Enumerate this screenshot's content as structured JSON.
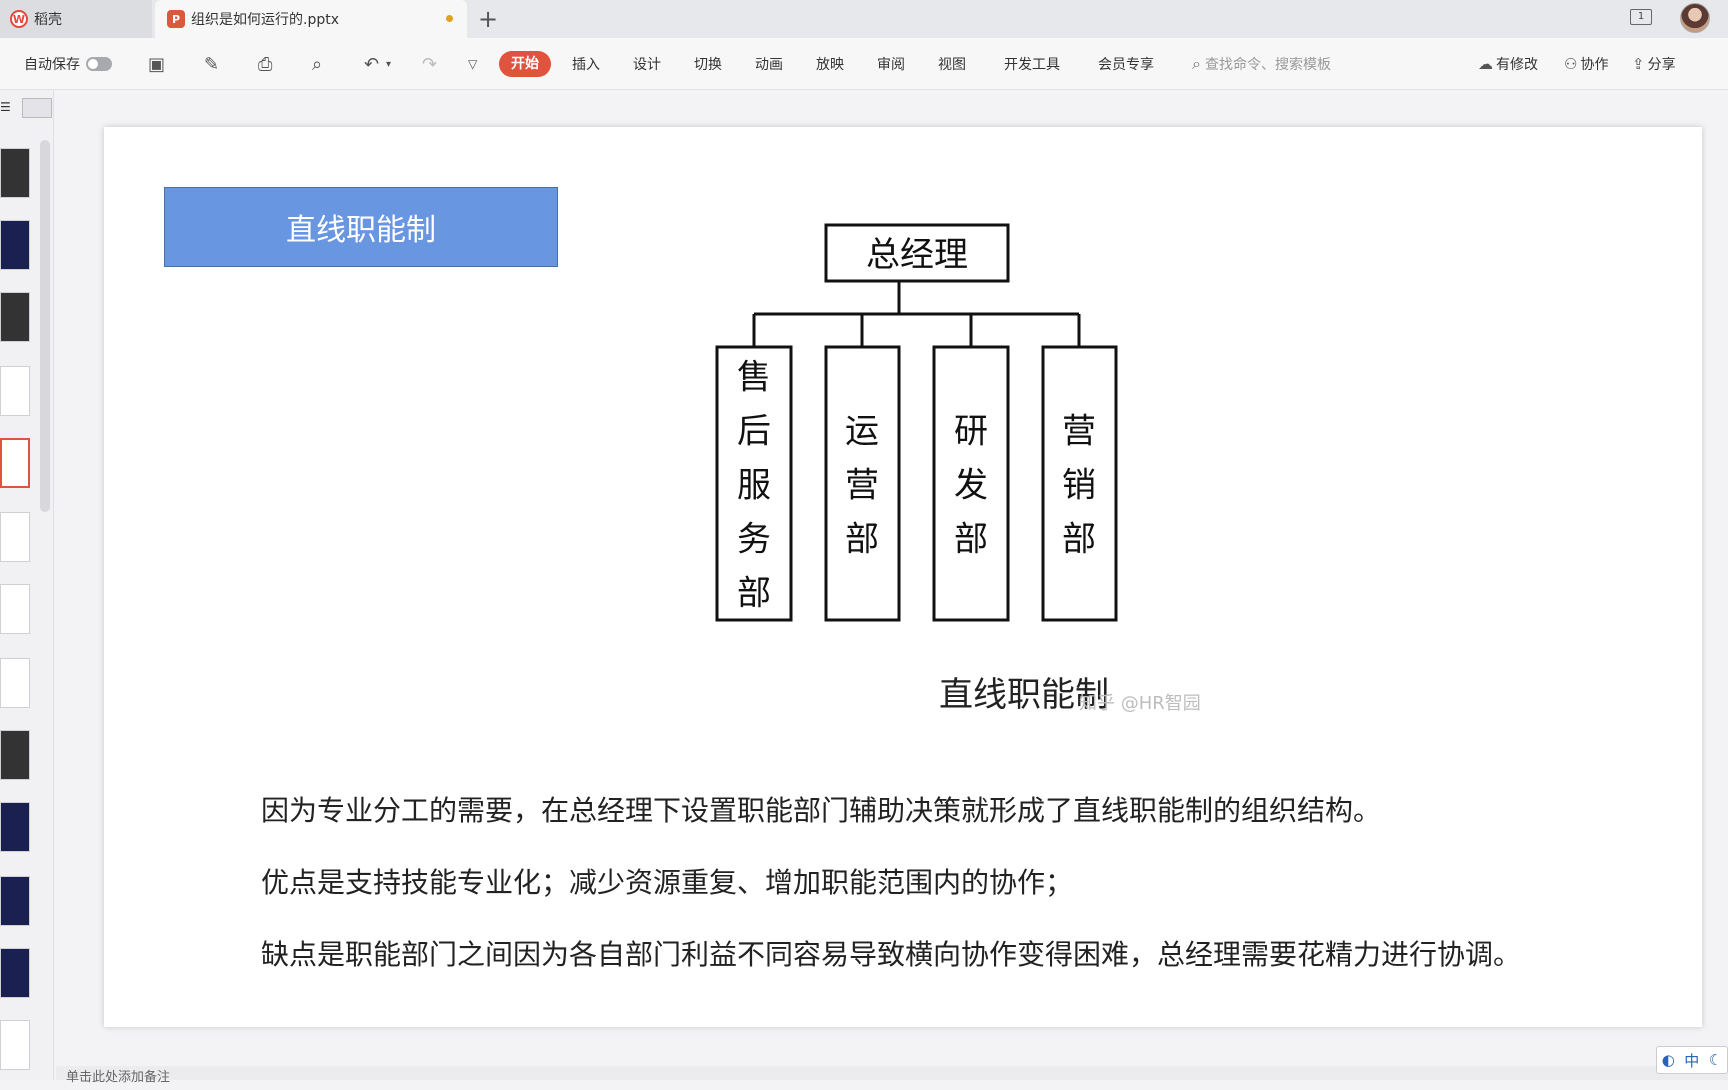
{
  "titlebar": {
    "home_tab": "稻壳",
    "doc_tab": "组织是如何运行的.pptx",
    "new_tab": "+",
    "window_count": "1"
  },
  "toolbar": {
    "autosave": "自动保存",
    "menus": [
      "开始",
      "插入",
      "设计",
      "切换",
      "动画",
      "放映",
      "审阅",
      "视图",
      "开发工具",
      "会员专享"
    ],
    "search_placeholder": "查找命令、搜索模板",
    "modified": "有修改",
    "collaborate": "协作",
    "share": "分享"
  },
  "slide": {
    "title": "直线职能制",
    "org_chart": {
      "root": "总经理",
      "departments": [
        "售后服务部",
        "运营部",
        "研发部",
        "营销部"
      ],
      "caption": "直线职能制"
    },
    "watermark": "知乎 @HR智园",
    "paragraphs": [
      "因为专业分工的需要，在总经理下设置职能部门辅助决策就形成了直线职能制的组织结构。",
      "优点是支持技能专业化；减少资源重复、增加职能范围内的协作；",
      "缺点是职能部门之间因为各自部门利益不同容易导致横向协作变得困难，总经理需要花精力进行协调。"
    ]
  },
  "notes_placeholder": "单击此处添加备注",
  "ime": "中"
}
